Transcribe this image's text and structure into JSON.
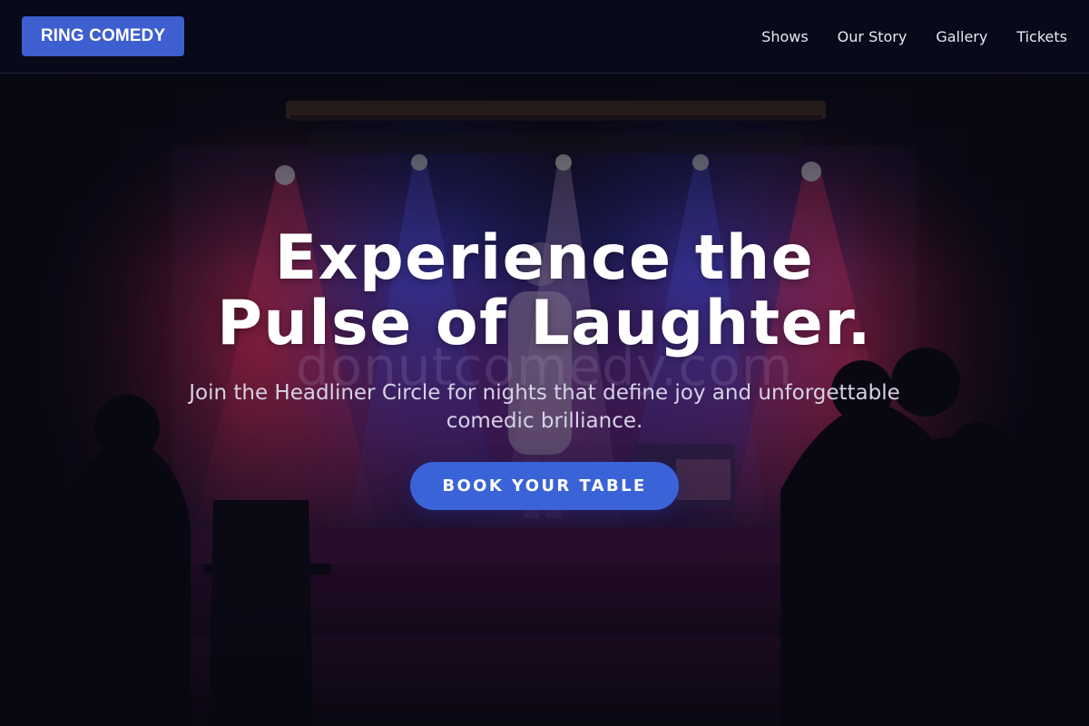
{
  "brand": {
    "name": "RING COMEDY"
  },
  "nav": {
    "items": [
      "Shows",
      "Our Story",
      "Gallery",
      "Tickets"
    ]
  },
  "hero": {
    "headline_line1": "Experience the",
    "headline_line2": "Pulse of Laughter.",
    "subtitle_line1": "Join the Headliner Circle for nights that define joy and unforgettable",
    "subtitle_line2": "comedic brilliance.",
    "cta_label": "BOOK YOUR TABLE",
    "watermark": "donutcomedy.com"
  },
  "colors": {
    "brand_accent": "#3e5fd0",
    "cta": "#3b63d8",
    "header_bg": "#080a1a",
    "stage_red": "#d8284e",
    "stage_blue": "#3b3fd8",
    "stage_purple": "#7a1f8c"
  }
}
